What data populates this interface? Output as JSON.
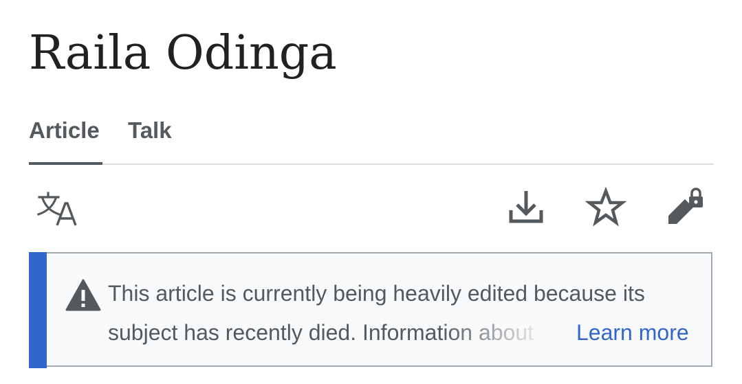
{
  "page": {
    "title": "Raila Odinga"
  },
  "tabs": [
    {
      "label": "Article",
      "active": true
    },
    {
      "label": "Talk",
      "active": false
    }
  ],
  "toolbar": {
    "icons": [
      "language-icon",
      "download-icon",
      "star-icon",
      "edit-lock-icon"
    ]
  },
  "notice": {
    "icon": "warning-icon",
    "line1": "This article is currently being heavily edited because its",
    "line2": "subject has recently died. Information about",
    "learn_more": "Learn more"
  },
  "colors": {
    "accent": "#3366cc",
    "text": "#202122",
    "muted": "#54595d",
    "notice_bg": "#f8f9fa",
    "border": "#a2a9b1"
  }
}
